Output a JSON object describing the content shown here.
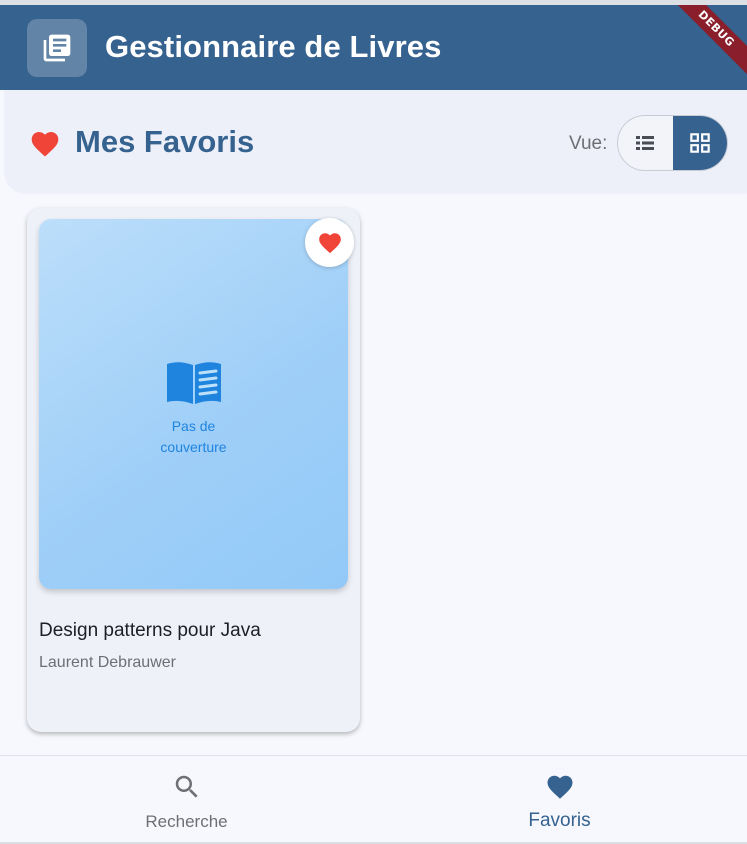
{
  "app_bar": {
    "title": "Gestionnaire de Livres",
    "icon": "library-books-icon",
    "debug_label": "DEBUG",
    "color": "#36628f"
  },
  "favorites_header": {
    "title": "Mes Favoris",
    "icon": "heart-icon",
    "view_label": "Vue:",
    "view_options": [
      {
        "name": "list",
        "icon": "list-view-icon",
        "selected": false
      },
      {
        "name": "grid",
        "icon": "grid-view-icon",
        "selected": true
      }
    ]
  },
  "books": [
    {
      "title": "Design patterns pour Java",
      "author": "Laurent Debrauwer",
      "cover_placeholder": "Pas de couverture",
      "favorite": true
    }
  ],
  "bottom_nav": {
    "items": [
      {
        "label": "Recherche",
        "icon": "search-icon",
        "active": false
      },
      {
        "label": "Favoris",
        "icon": "heart-icon",
        "active": true
      }
    ]
  },
  "colors": {
    "primary": "#36628f",
    "favorite_red": "#f04438",
    "cover_text": "#1f84de"
  }
}
